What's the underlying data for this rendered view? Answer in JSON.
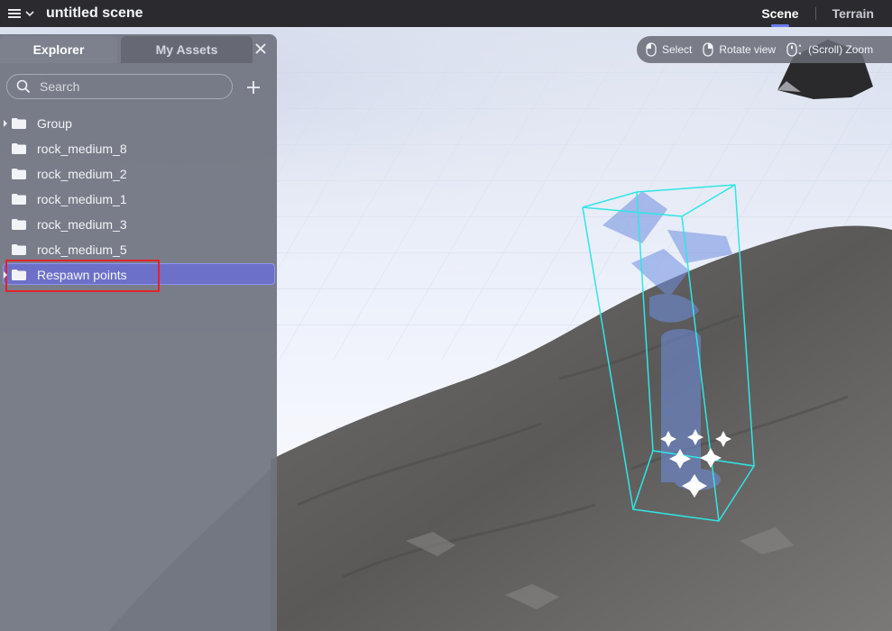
{
  "topbar": {
    "title": "untitled scene",
    "tabs": [
      {
        "label": "Scene",
        "active": true
      },
      {
        "label": "Terrain",
        "active": false
      }
    ]
  },
  "panel": {
    "tabs": [
      {
        "label": "Explorer",
        "active": true
      },
      {
        "label": "My Assets",
        "active": false
      }
    ],
    "search": {
      "placeholder": "Search",
      "value": ""
    },
    "tree": [
      {
        "label": "Group",
        "expandable": true,
        "selected": false
      },
      {
        "label": "rock_medium_8",
        "expandable": false,
        "selected": false
      },
      {
        "label": "rock_medium_2",
        "expandable": false,
        "selected": false
      },
      {
        "label": "rock_medium_1",
        "expandable": false,
        "selected": false
      },
      {
        "label": "rock_medium_3",
        "expandable": false,
        "selected": false
      },
      {
        "label": "rock_medium_5",
        "expandable": false,
        "selected": false
      },
      {
        "label": "Respawn points",
        "expandable": true,
        "selected": true
      }
    ]
  },
  "viewport": {
    "hints": [
      {
        "icon": "mouse-left-click-icon",
        "label": "Select"
      },
      {
        "icon": "mouse-right-click-icon",
        "label": "Rotate view"
      },
      {
        "icon": "mouse-scroll-icon",
        "label": "(Scroll) Zoom"
      }
    ]
  },
  "colors": {
    "accent": "#6b7cf5",
    "selection": "#6d70c8",
    "highlight": "#e0242c",
    "gizmo": "#2fe6e6"
  }
}
